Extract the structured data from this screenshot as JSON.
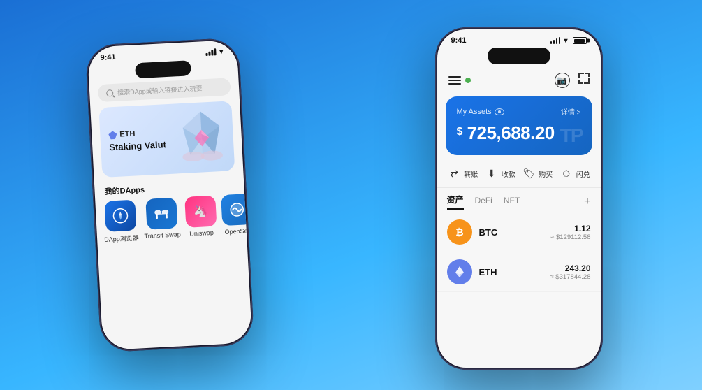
{
  "background": {
    "gradient_start": "#1a6fd4",
    "gradient_end": "#38b6ff"
  },
  "left_phone": {
    "time": "9:41",
    "search_placeholder": "搜索DApp或输入链接进入玩耍",
    "banner": {
      "coin": "ETH",
      "subtitle_line1": "Staking Valut"
    },
    "dapps_label": "我的DApps",
    "dapps": [
      {
        "name": "DApp浏览器",
        "icon_type": "browser"
      },
      {
        "name": "Transit Swap",
        "icon_type": "transit"
      },
      {
        "name": "Uniswap",
        "icon_type": "uniswap"
      },
      {
        "name": "OpenSea",
        "icon_type": "opensea"
      }
    ]
  },
  "right_phone": {
    "time": "9:41",
    "assets_card": {
      "title": "My Assets",
      "detail_label": "详情 >",
      "amount": "725,688.20",
      "currency_symbol": "$",
      "watermark": "TP"
    },
    "actions": [
      {
        "label": "转账",
        "icon": "↺"
      },
      {
        "label": "收款",
        "icon": "↓"
      },
      {
        "label": "购买",
        "icon": "⊕"
      },
      {
        "label": "闪兑",
        "icon": "⏱"
      }
    ],
    "tabs": [
      {
        "label": "资产",
        "active": true
      },
      {
        "label": "DeFi",
        "active": false
      },
      {
        "label": "NFT",
        "active": false
      }
    ],
    "tab_plus": "+",
    "assets": [
      {
        "coin": "BTC",
        "icon_type": "btc",
        "amount": "1.12",
        "usd_value": "≈ $129112.58"
      },
      {
        "coin": "ETH",
        "icon_type": "eth",
        "amount": "243.20",
        "usd_value": "≈ $317844.28"
      }
    ]
  }
}
